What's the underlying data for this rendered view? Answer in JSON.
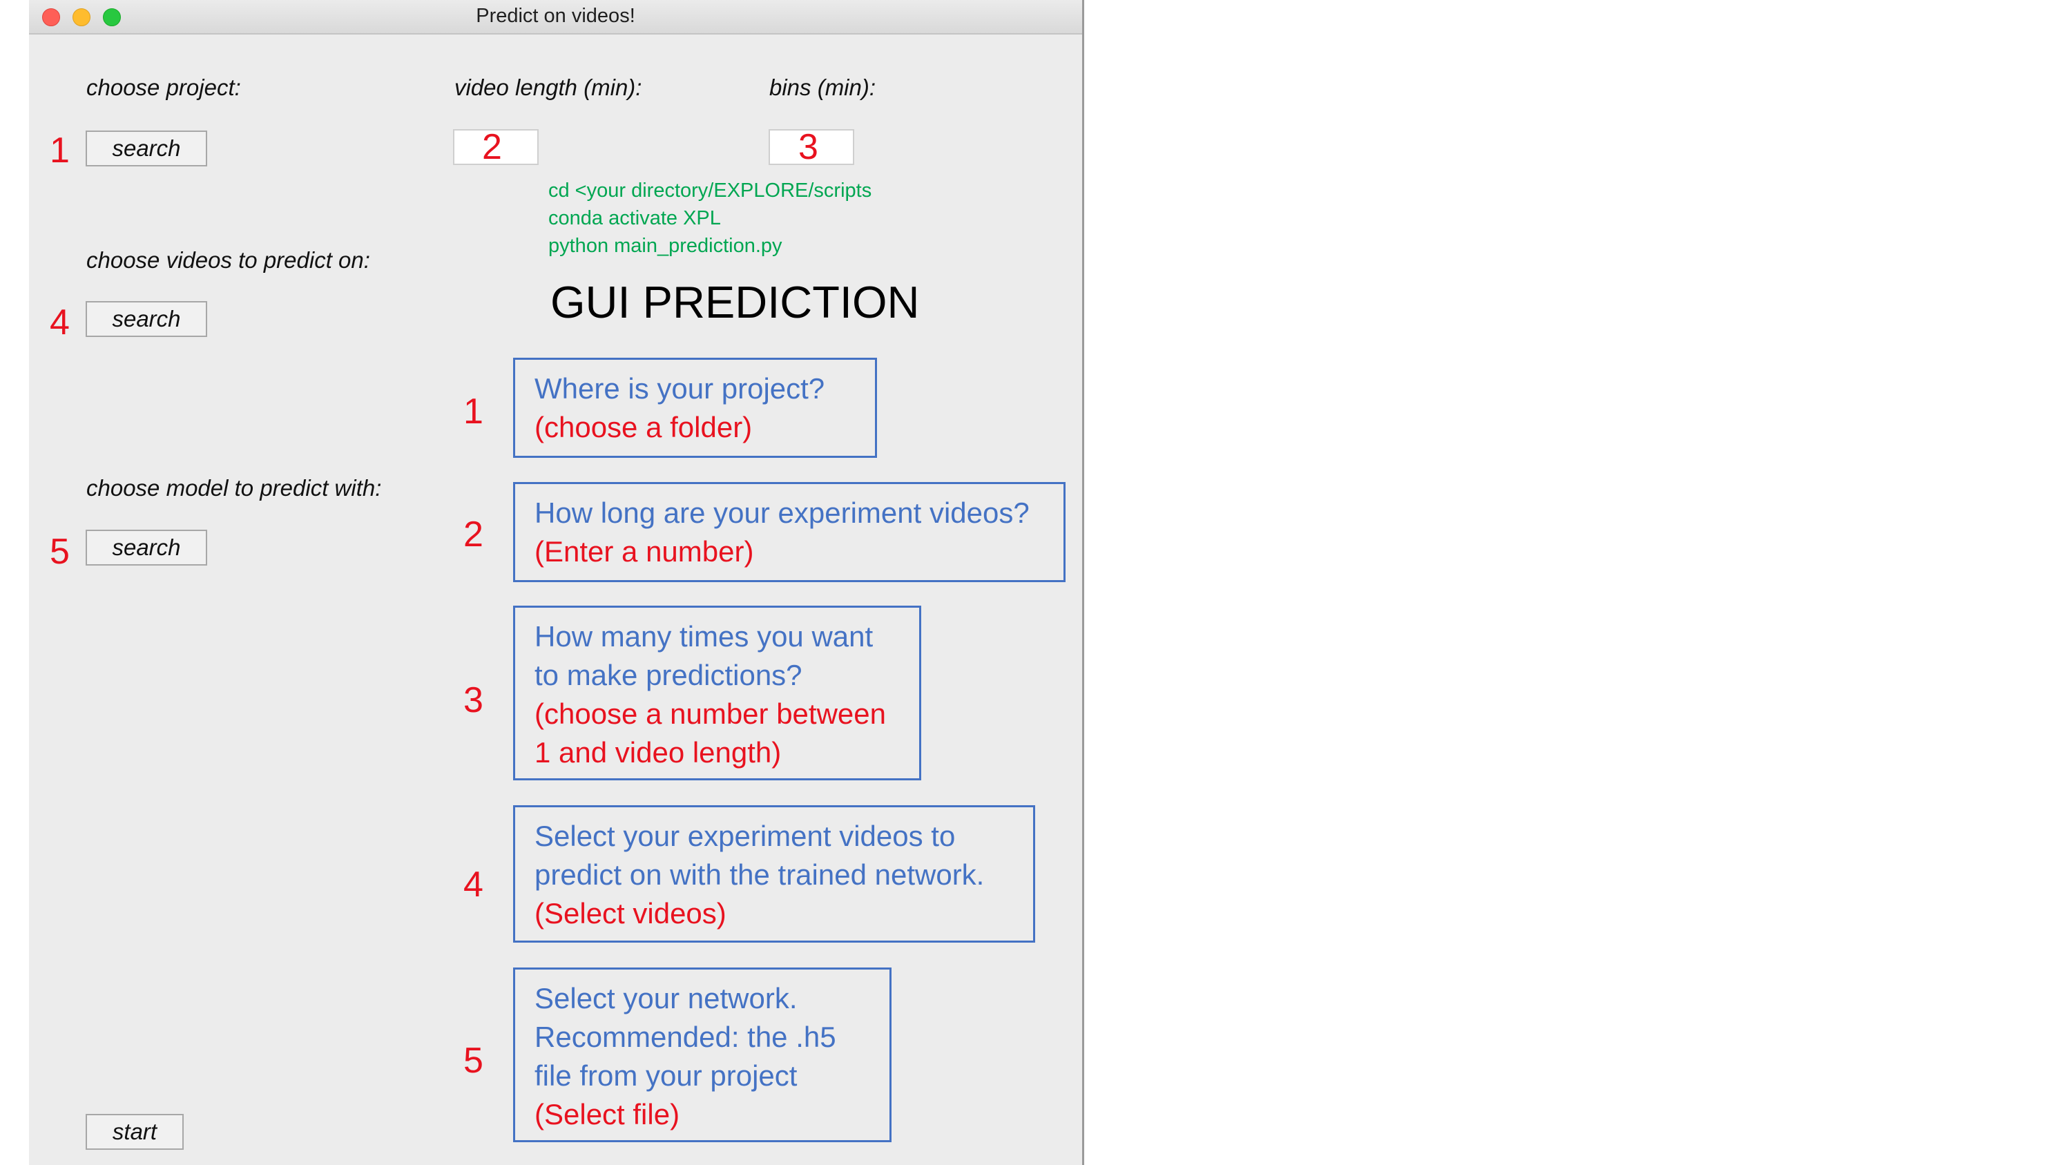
{
  "window": {
    "title": "Predict on videos!"
  },
  "form": {
    "project_label": "choose project:",
    "video_length_label": "video length (min):",
    "bins_label": "bins (min):",
    "videos_label": "choose videos to predict on:",
    "model_label": "choose model to predict with:",
    "search_label": "search",
    "start_label": "start",
    "video_length_value": "",
    "bins_value": ""
  },
  "annotations": {
    "n1": "1",
    "n2": "2",
    "n3": "3",
    "n4": "4",
    "n5": "5",
    "commands": [
      "cd <your directory/EXPLORE/scripts",
      "conda activate XPL",
      "python main_prediction.py"
    ],
    "heading": "GUI PREDICTION",
    "boxes": [
      {
        "lines": [
          "Where is your project?"
        ],
        "hint": [
          "(choose a folder)"
        ]
      },
      {
        "lines": [
          "How long are your experiment videos?"
        ],
        "hint": [
          "(Enter a number)"
        ]
      },
      {
        "lines": [
          "How many times you want",
          "to make predictions?"
        ],
        "hint": [
          "(choose a number between",
          "1 and video length)"
        ]
      },
      {
        "lines": [
          "Select your experiment videos to",
          "predict on with the trained network."
        ],
        "hint": [
          "(Select videos)"
        ]
      },
      {
        "lines": [
          "Select your network.",
          "Recommended: the .h5",
          "file from your project"
        ],
        "hint": [
          "(Select file)"
        ]
      }
    ]
  },
  "colors": {
    "annotation_red": "#e8121f",
    "annotation_blue": "#4472c4",
    "command_green": "#00a651",
    "window_bg": "#ececec"
  }
}
